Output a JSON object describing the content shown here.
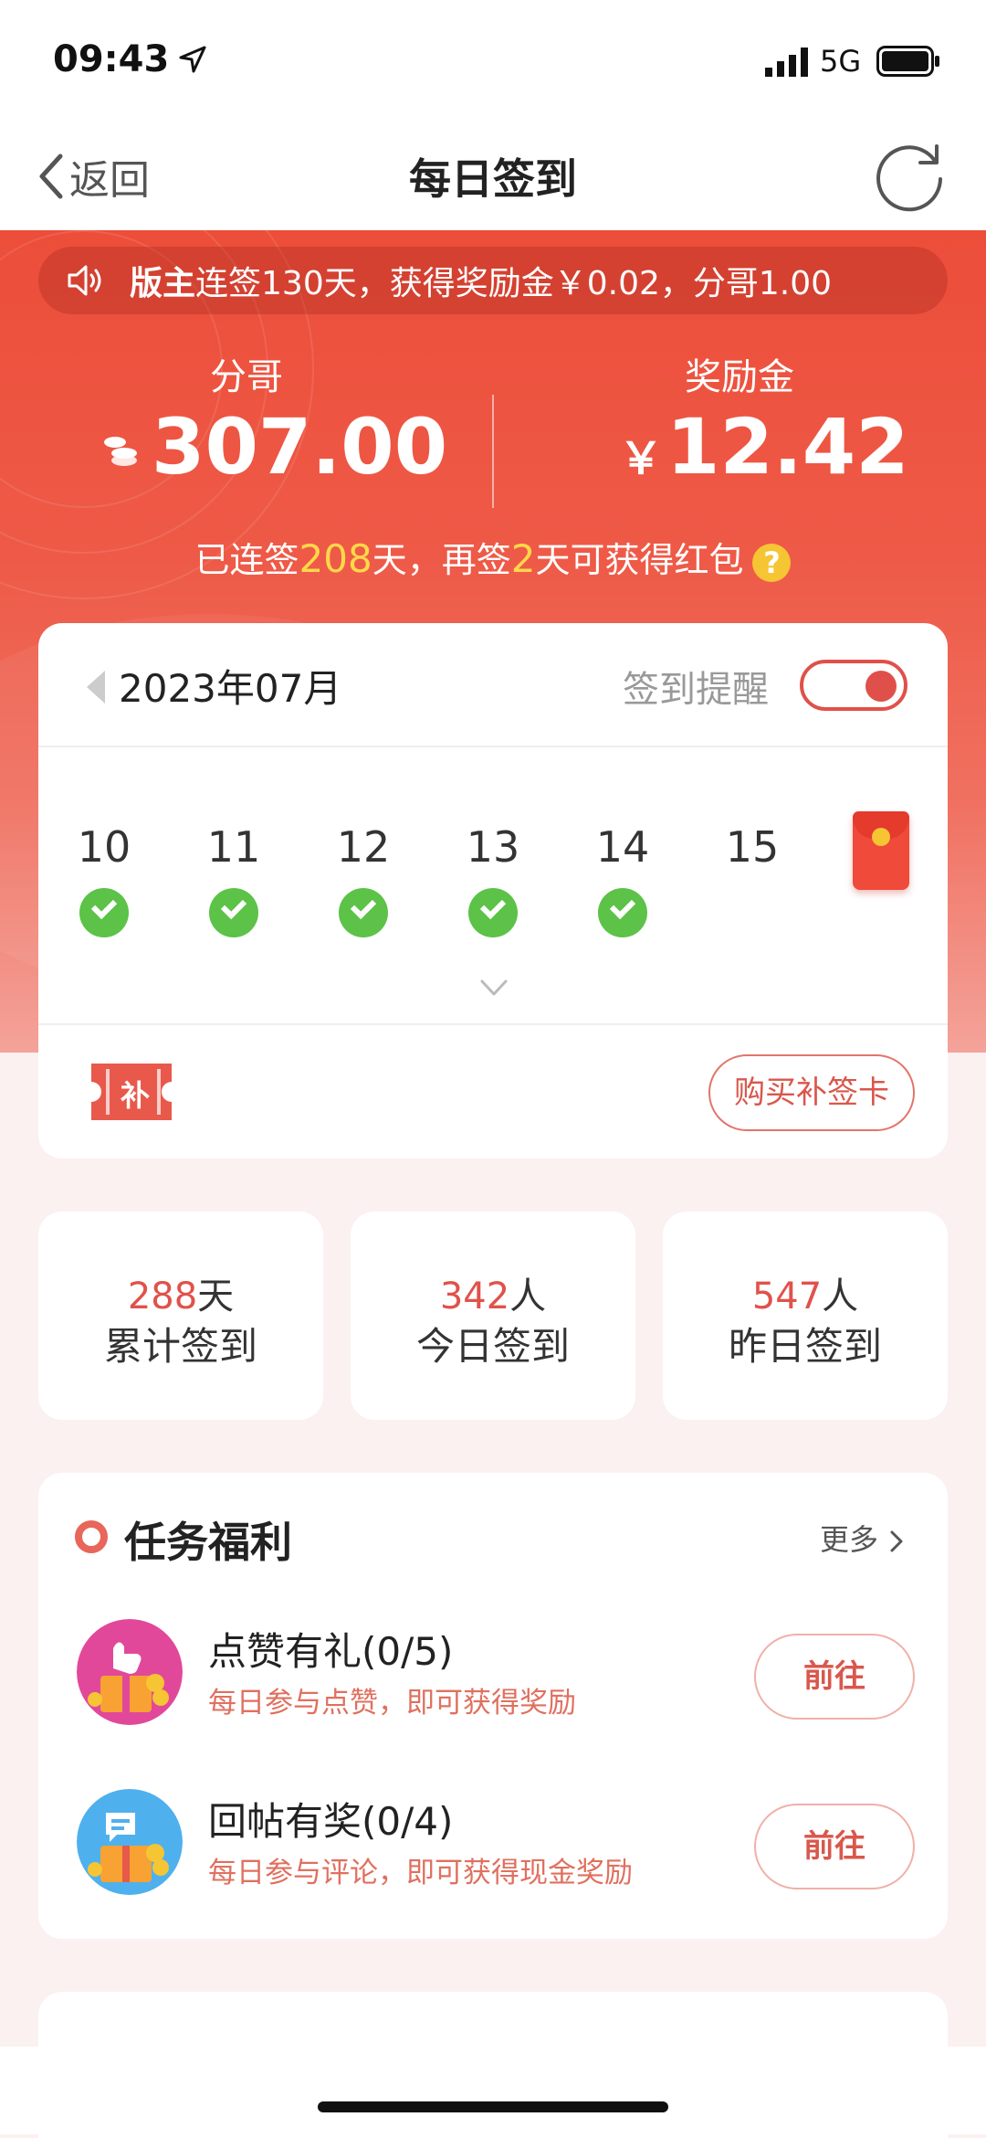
{
  "status_bar": {
    "time": "09:43",
    "network": "5G"
  },
  "nav": {
    "back_label": "返回",
    "title": "每日签到"
  },
  "notice": {
    "bold": "版主",
    "text": "连签130天，获得奖励金￥0.02，分哥1.00"
  },
  "stats": {
    "fen_label": "分哥",
    "fen_value": "307.00",
    "reward_label": "奖励金",
    "currency": "￥",
    "reward_value": "12.42"
  },
  "streak": {
    "p1": "已连签",
    "days": "208",
    "p2": "天，再签",
    "remain": "2",
    "p3": "天可获得红包",
    "help": "?"
  },
  "calendar": {
    "month": "2023年07月",
    "reminder_label": "签到提醒",
    "reminder_on": true,
    "days": [
      {
        "num": "10",
        "checked": true
      },
      {
        "num": "11",
        "checked": true
      },
      {
        "num": "12",
        "checked": true
      },
      {
        "num": "13",
        "checked": true
      },
      {
        "num": "14",
        "checked": true
      },
      {
        "num": "15",
        "checked": false
      }
    ],
    "ticket_text": "补",
    "buy_label": "购买补签卡"
  },
  "summary": [
    {
      "value": "288",
      "unit": "天",
      "label": "累计签到"
    },
    {
      "value": "342",
      "unit": "人",
      "label": "今日签到"
    },
    {
      "value": "547",
      "unit": "人",
      "label": "昨日签到"
    }
  ],
  "tasks": {
    "title": "任务福利",
    "more": "更多",
    "items": [
      {
        "name": "点赞有礼(0/5)",
        "desc": "每日参与点赞，即可获得奖励",
        "button": "前往"
      },
      {
        "name": "回帖有奖(0/4)",
        "desc": "每日参与评论，即可获得现金奖励",
        "button": "前往"
      }
    ]
  },
  "colors": {
    "primary_red": "#ec4e3a",
    "check_green": "#5cc248",
    "gold": "#f6c533"
  }
}
